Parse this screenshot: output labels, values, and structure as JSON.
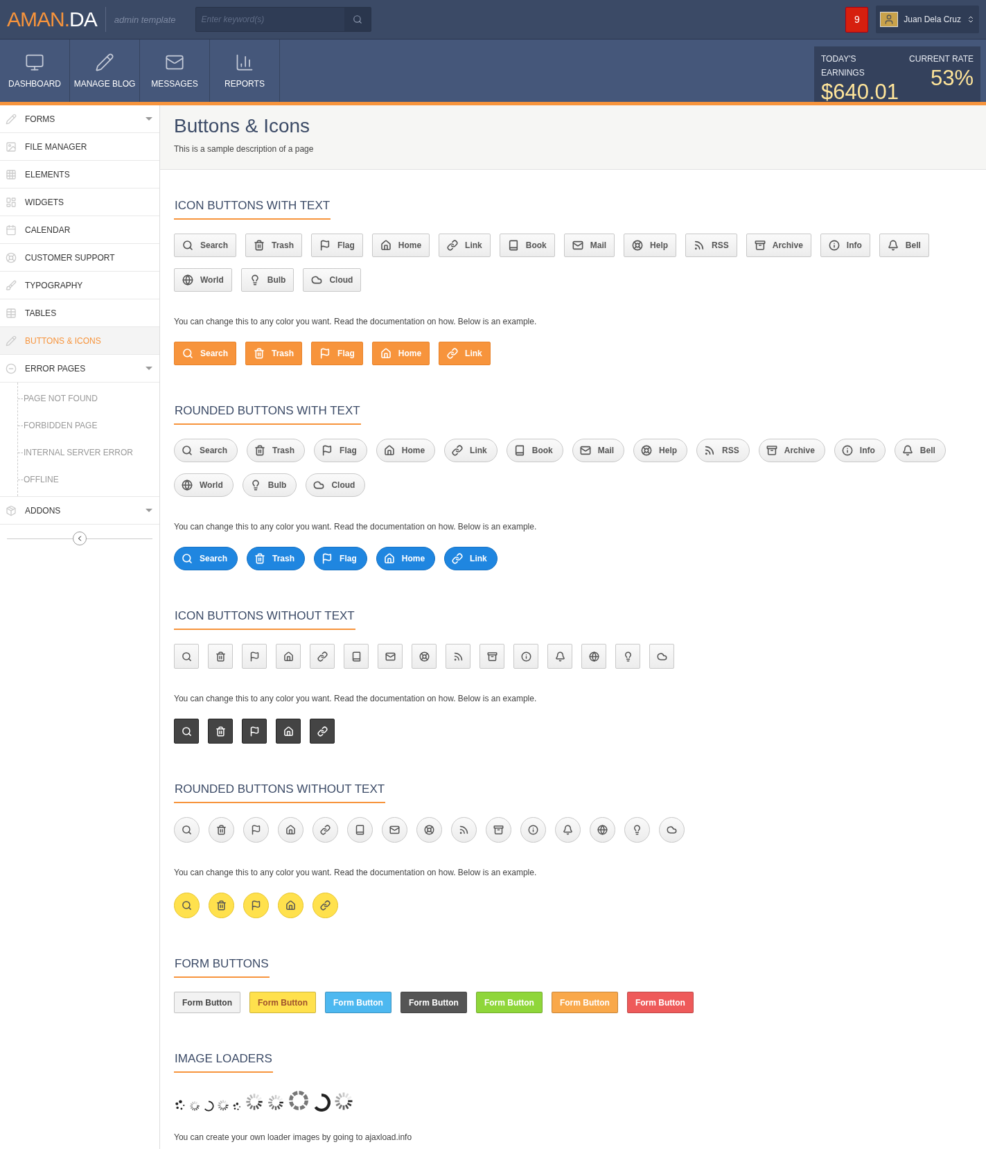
{
  "header": {
    "logo_left": "AMAN.",
    "logo_right": "DA",
    "tagline": "admin template",
    "search": {
      "placeholder": "Enter keyword(s)"
    },
    "notifications": "9",
    "user": "Juan Dela Cruz"
  },
  "nav": [
    {
      "label": "DASHBOARD"
    },
    {
      "label": "MANAGE BLOG"
    },
    {
      "label": "MESSAGES"
    },
    {
      "label": "REPORTS"
    }
  ],
  "earnings": {
    "label": "TODAY'S EARNINGS",
    "value": "$640.01",
    "rate_label": "CURRENT RATE",
    "rate": "53%"
  },
  "sidebar": {
    "items": [
      {
        "label": "FORMS",
        "kind": "group",
        "selected": false
      },
      {
        "label": "FILE MANAGER",
        "kind": "link",
        "selected": false
      },
      {
        "label": "ELEMENTS",
        "kind": "link",
        "selected": false
      },
      {
        "label": "WIDGETS",
        "kind": "link",
        "selected": false
      },
      {
        "label": "CALENDAR",
        "kind": "link",
        "selected": false
      },
      {
        "label": "CUSTOMER SUPPORT",
        "kind": "link",
        "selected": false
      },
      {
        "label": "TYPOGRAPHY",
        "kind": "link",
        "selected": false
      },
      {
        "label": "TABLES",
        "kind": "link",
        "selected": false
      },
      {
        "label": "BUTTONS & ICONS",
        "kind": "link",
        "selected": true
      },
      {
        "label": "ERROR PAGES",
        "kind": "group",
        "selected": false,
        "children": [
          {
            "label": "PAGE NOT FOUND"
          },
          {
            "label": "FORBIDDEN PAGE"
          },
          {
            "label": "INTERNAL SERVER ERROR"
          },
          {
            "label": "OFFLINE"
          }
        ]
      },
      {
        "label": "ADDONS",
        "kind": "group",
        "selected": false
      }
    ]
  },
  "page": {
    "title": "Buttons & Icons",
    "description": "This is a sample description of a page"
  },
  "sections": [
    {
      "title": "ICON BUTTONS WITH TEXT",
      "kind": "square_text",
      "buttons": [
        "Search",
        "Trash",
        "Flag",
        "Home",
        "Link",
        "Book",
        "Mail",
        "Help",
        "RSS",
        "Archive",
        "Info",
        "Bell",
        "World",
        "Bulb",
        "Cloud"
      ],
      "note": "You can change this to any color you want. Read the documentation on how. Below is an example.",
      "examples": [
        "Search",
        "Trash",
        "Flag",
        "Home",
        "Link"
      ]
    },
    {
      "title": "ROUNDED BUTTONS WITH TEXT",
      "kind": "round_text",
      "buttons": [
        "Search",
        "Trash",
        "Flag",
        "Home",
        "Link",
        "Book",
        "Mail",
        "Help",
        "RSS",
        "Archive",
        "Info",
        "Bell",
        "World",
        "Bulb",
        "Cloud"
      ],
      "note": "You can change this to any color you want. Read the documentation on how. Below is an example.",
      "examples": [
        "Search",
        "Trash",
        "Flag",
        "Home",
        "Link"
      ]
    },
    {
      "title": "ICON BUTTONS WITHOUT TEXT",
      "kind": "square_icon",
      "buttons": [
        {
          "kind": "icon"
        },
        {
          "kind": "icon"
        },
        {
          "kind": "icon"
        },
        {
          "kind": "icon"
        },
        {
          "kind": "icon"
        },
        {
          "kind": "icon"
        },
        {
          "kind": "icon"
        },
        {
          "kind": "icon"
        },
        {
          "kind": "icon"
        },
        {
          "kind": "icon"
        },
        {
          "kind": "icon"
        },
        {
          "kind": "icon"
        },
        {
          "kind": "icon"
        },
        {
          "kind": "icon"
        },
        {
          "kind": "icon"
        }
      ],
      "note": "You can change this to any color you want. Read the documentation on how. Below is an example.",
      "examples": [
        {
          "kind": "icon"
        },
        {
          "kind": "icon"
        },
        {
          "kind": "icon"
        },
        {
          "kind": "icon"
        },
        {
          "kind": "icon"
        }
      ]
    },
    {
      "title": "ROUNDED BUTTONS WITHOUT TEXT",
      "kind": "round_icon",
      "buttons": [
        {
          "kind": "icon"
        },
        {
          "kind": "icon"
        },
        {
          "kind": "icon"
        },
        {
          "kind": "icon"
        },
        {
          "kind": "icon"
        },
        {
          "kind": "icon"
        },
        {
          "kind": "icon"
        },
        {
          "kind": "icon"
        },
        {
          "kind": "icon"
        },
        {
          "kind": "icon"
        },
        {
          "kind": "icon"
        },
        {
          "kind": "icon"
        },
        {
          "kind": "icon"
        },
        {
          "kind": "icon"
        },
        {
          "kind": "icon"
        }
      ],
      "note": "You can change this to any color you want. Read the documentation on how. Below is an example.",
      "examples": [
        {
          "kind": "icon"
        },
        {
          "kind": "icon"
        },
        {
          "kind": "icon"
        },
        {
          "kind": "icon"
        },
        {
          "kind": "icon"
        }
      ]
    }
  ],
  "form_buttons": {
    "title": "FORM BUTTONS",
    "buttons": [
      {
        "label": "Form Button",
        "color": "#f2f2f2"
      },
      {
        "label": "Form Button",
        "color": "#ffe14d"
      },
      {
        "label": "Form Button",
        "color": "#4db8f0"
      },
      {
        "label": "Form Button",
        "color": "#555555"
      },
      {
        "label": "Form Button",
        "color": "#8fd63a"
      },
      {
        "label": "Form Button",
        "color": "#f9a84a"
      },
      {
        "label": "Form Button",
        "color": "#ee5a5a"
      }
    ]
  },
  "loaders": {
    "title": "IMAGE LOADERS",
    "note": "You can create your own loader images by going to ajaxload.info"
  }
}
